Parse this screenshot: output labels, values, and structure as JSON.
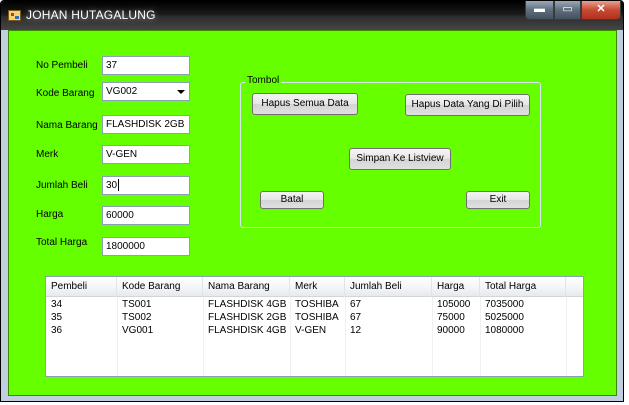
{
  "window": {
    "title": "JOHAN HUTAGALUNG",
    "controls": {
      "minimize": "▬",
      "maximize": "▭",
      "close": "✕"
    }
  },
  "form": {
    "fields": [
      {
        "label": "No Pembeli",
        "value": "37"
      },
      {
        "label": "Kode Barang",
        "value": "VG002"
      },
      {
        "label": "Nama Barang",
        "value": "FLASHDISK 2GB"
      },
      {
        "label": "Merk",
        "value": "V-GEN"
      },
      {
        "label": "Jumlah Beli",
        "value": "30"
      },
      {
        "label": "Harga",
        "value": "60000"
      },
      {
        "label": "Total Harga",
        "value": "1800000"
      }
    ]
  },
  "group": {
    "title": "Tombol",
    "buttons": {
      "hapus_semua": "Hapus Semua Data",
      "hapus_pilih": "Hapus Data Yang Di Pilih",
      "simpan": "Simpan Ke Listview",
      "batal": "Batal",
      "exit": "Exit"
    }
  },
  "listview": {
    "columns": [
      "Pembeli",
      "Kode Barang",
      "Nama Barang",
      "Merk",
      "Jumlah Beli",
      "Harga",
      "Total Harga"
    ],
    "rows": [
      [
        "34",
        "TS001",
        "FLASHDISK 4GB",
        "TOSHIBA",
        "67",
        "105000",
        "7035000"
      ],
      [
        "35",
        "TS002",
        "FLASHDISK 2GB",
        "TOSHIBA",
        "67",
        "75000",
        "5025000"
      ],
      [
        "36",
        "VG001",
        "FLASHDISK 4GB",
        "V-GEN",
        "12",
        "90000",
        "1080000"
      ]
    ]
  },
  "colors": {
    "client_background": "#66ff00",
    "titlebar": "#000000",
    "close_button": "#c64a33"
  }
}
